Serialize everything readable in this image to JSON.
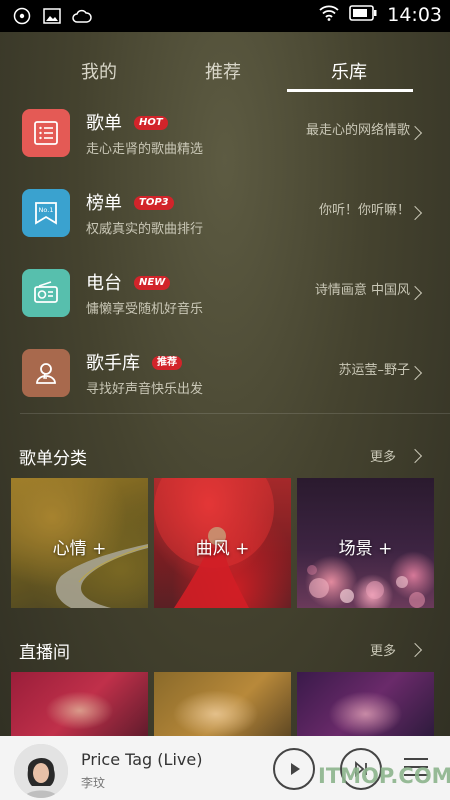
{
  "status_bar": {
    "time": "14:03"
  },
  "tabs": [
    {
      "label": "我的"
    },
    {
      "label": "推荐"
    },
    {
      "label": "乐库",
      "active": true
    }
  ],
  "items": [
    {
      "title": "歌单",
      "badge": "HOT",
      "subtitle": "走心走肾的歌曲精选",
      "right": "最走心的网络情歌",
      "icon": "playlist-icon",
      "color": "#e45a55"
    },
    {
      "title": "榜单",
      "badge": "TOP3",
      "subtitle": "权威真实的歌曲排行",
      "right": "你听！你听嘛！",
      "icon": "no1-ribbon-icon",
      "color": "#3aa2cf"
    },
    {
      "title": "电台",
      "badge": "NEW",
      "subtitle": "慵懒享受随机好音乐",
      "right": "诗情画意  中国风",
      "icon": "radio-icon",
      "color": "#57bfad"
    },
    {
      "title": "歌手库",
      "badge": "推荐",
      "subtitle": "寻找好声音快乐出发",
      "right": "苏运莹–野子",
      "icon": "singer-icon",
      "color": "#a8694d"
    }
  ],
  "categories_section": {
    "title": "歌单分类",
    "more": "更多",
    "tiles": [
      {
        "label": "心情 +"
      },
      {
        "label": "曲风 +"
      },
      {
        "label": "场景 +"
      }
    ]
  },
  "live_section": {
    "title": "直播间",
    "more": "更多"
  },
  "player": {
    "song": "Price Tag (Live)",
    "artist": "李玟"
  },
  "watermark": "ITMOP.COM"
}
